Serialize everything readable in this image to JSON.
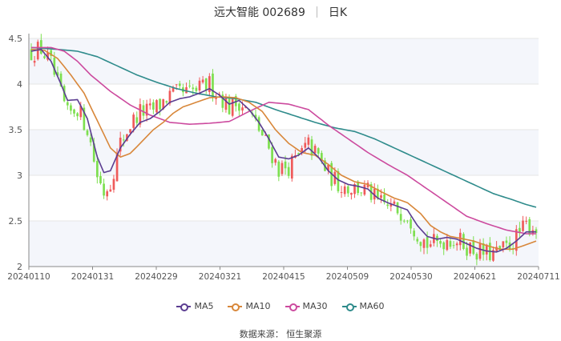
{
  "header": {
    "stock": "远大智能 002689",
    "period": "日K"
  },
  "source": "数据来源： 恒生聚源",
  "colors": {
    "up": "#ef5a5a",
    "down": "#7ddf4f",
    "ma5": "#5b3d91",
    "ma10": "#d8873a",
    "ma30": "#cc4a9e",
    "ma60": "#2e8b8b",
    "grid": "#e6e6e6",
    "band": "#f4f6fb"
  },
  "chart_data": {
    "type": "candlestick",
    "title": "远大智能 002689 日K",
    "ylim": [
      2,
      4.5
    ],
    "yticks": [
      "2",
      "2.5",
      "3",
      "3.5",
      "4",
      "4.5"
    ],
    "xtick_labels": [
      "20240110",
      "20240131",
      "20240229",
      "20240321",
      "20240415",
      "20240509",
      "20240530",
      "20240621",
      "20240711"
    ],
    "legend": [
      "MA5",
      "MA10",
      "MA30",
      "MA60"
    ],
    "legend_position": "bottom",
    "ma_series": {
      "MA5": [
        [
          0,
          4.36
        ],
        [
          3,
          4.38
        ],
        [
          6,
          4.25
        ],
        [
          9,
          4.0
        ],
        [
          11,
          3.82
        ],
        [
          14,
          3.83
        ],
        [
          17,
          3.62
        ],
        [
          20,
          3.2
        ],
        [
          22,
          3.03
        ],
        [
          24,
          3.05
        ],
        [
          27,
          3.3
        ],
        [
          30,
          3.45
        ],
        [
          33,
          3.58
        ],
        [
          36,
          3.62
        ],
        [
          39,
          3.7
        ],
        [
          42,
          3.8
        ],
        [
          45,
          3.84
        ],
        [
          48,
          3.86
        ],
        [
          51,
          3.9
        ],
        [
          54,
          3.95
        ],
        [
          57,
          3.88
        ],
        [
          60,
          3.78
        ],
        [
          63,
          3.82
        ],
        [
          66,
          3.72
        ],
        [
          69,
          3.58
        ],
        [
          72,
          3.4
        ],
        [
          75,
          3.2
        ],
        [
          78,
          3.18
        ],
        [
          81,
          3.22
        ],
        [
          84,
          3.3
        ],
        [
          87,
          3.2
        ],
        [
          90,
          3.05
        ],
        [
          93,
          2.95
        ],
        [
          96,
          2.9
        ],
        [
          99,
          2.88
        ],
        [
          102,
          2.85
        ],
        [
          105,
          2.75
        ],
        [
          108,
          2.7
        ],
        [
          111,
          2.66
        ],
        [
          114,
          2.62
        ],
        [
          117,
          2.45
        ],
        [
          120,
          2.33
        ],
        [
          123,
          2.3
        ],
        [
          126,
          2.32
        ],
        [
          129,
          2.3
        ],
        [
          132,
          2.25
        ],
        [
          135,
          2.2
        ],
        [
          138,
          2.17
        ],
        [
          141,
          2.16
        ],
        [
          144,
          2.2
        ],
        [
          147,
          2.28
        ],
        [
          150,
          2.38
        ],
        [
          153,
          2.38
        ]
      ],
      "MA10": [
        [
          0,
          4.38
        ],
        [
          4,
          4.37
        ],
        [
          8,
          4.28
        ],
        [
          12,
          4.1
        ],
        [
          16,
          3.9
        ],
        [
          20,
          3.6
        ],
        [
          24,
          3.3
        ],
        [
          27,
          3.2
        ],
        [
          30,
          3.24
        ],
        [
          33,
          3.35
        ],
        [
          37,
          3.5
        ],
        [
          40,
          3.58
        ],
        [
          43,
          3.68
        ],
        [
          46,
          3.75
        ],
        [
          50,
          3.8
        ],
        [
          54,
          3.85
        ],
        [
          58,
          3.86
        ],
        [
          62,
          3.85
        ],
        [
          66,
          3.8
        ],
        [
          70,
          3.7
        ],
        [
          74,
          3.5
        ],
        [
          78,
          3.35
        ],
        [
          82,
          3.25
        ],
        [
          86,
          3.22
        ],
        [
          90,
          3.12
        ],
        [
          94,
          3.0
        ],
        [
          98,
          2.93
        ],
        [
          102,
          2.9
        ],
        [
          106,
          2.82
        ],
        [
          110,
          2.75
        ],
        [
          114,
          2.7
        ],
        [
          118,
          2.58
        ],
        [
          121,
          2.45
        ],
        [
          124,
          2.38
        ],
        [
          127,
          2.33
        ],
        [
          130,
          2.31
        ],
        [
          134,
          2.28
        ],
        [
          138,
          2.23
        ],
        [
          142,
          2.19
        ],
        [
          146,
          2.19
        ],
        [
          150,
          2.24
        ],
        [
          153,
          2.28
        ]
      ],
      "MA30": [
        [
          0,
          4.4
        ],
        [
          6,
          4.4
        ],
        [
          10,
          4.36
        ],
        [
          14,
          4.25
        ],
        [
          18,
          4.1
        ],
        [
          24,
          3.92
        ],
        [
          30,
          3.77
        ],
        [
          36,
          3.66
        ],
        [
          42,
          3.58
        ],
        [
          48,
          3.56
        ],
        [
          54,
          3.57
        ],
        [
          60,
          3.59
        ],
        [
          66,
          3.7
        ],
        [
          72,
          3.8
        ],
        [
          78,
          3.78
        ],
        [
          84,
          3.72
        ],
        [
          90,
          3.55
        ],
        [
          96,
          3.4
        ],
        [
          102,
          3.25
        ],
        [
          108,
          3.12
        ],
        [
          114,
          3.0
        ],
        [
          120,
          2.85
        ],
        [
          126,
          2.7
        ],
        [
          132,
          2.55
        ],
        [
          138,
          2.47
        ],
        [
          144,
          2.4
        ],
        [
          150,
          2.36
        ],
        [
          153,
          2.36
        ]
      ],
      "MA60": [
        [
          0,
          4.4
        ],
        [
          8,
          4.38
        ],
        [
          14,
          4.36
        ],
        [
          20,
          4.3
        ],
        [
          26,
          4.2
        ],
        [
          32,
          4.1
        ],
        [
          38,
          4.02
        ],
        [
          44,
          3.95
        ],
        [
          50,
          3.9
        ],
        [
          56,
          3.86
        ],
        [
          62,
          3.84
        ],
        [
          68,
          3.8
        ],
        [
          74,
          3.72
        ],
        [
          80,
          3.65
        ],
        [
          86,
          3.58
        ],
        [
          92,
          3.52
        ],
        [
          98,
          3.48
        ],
        [
          104,
          3.4
        ],
        [
          110,
          3.3
        ],
        [
          116,
          3.2
        ],
        [
          122,
          3.1
        ],
        [
          128,
          3.0
        ],
        [
          134,
          2.9
        ],
        [
          140,
          2.8
        ],
        [
          146,
          2.73
        ],
        [
          150,
          2.68
        ],
        [
          153,
          2.65
        ]
      ]
    }
  }
}
